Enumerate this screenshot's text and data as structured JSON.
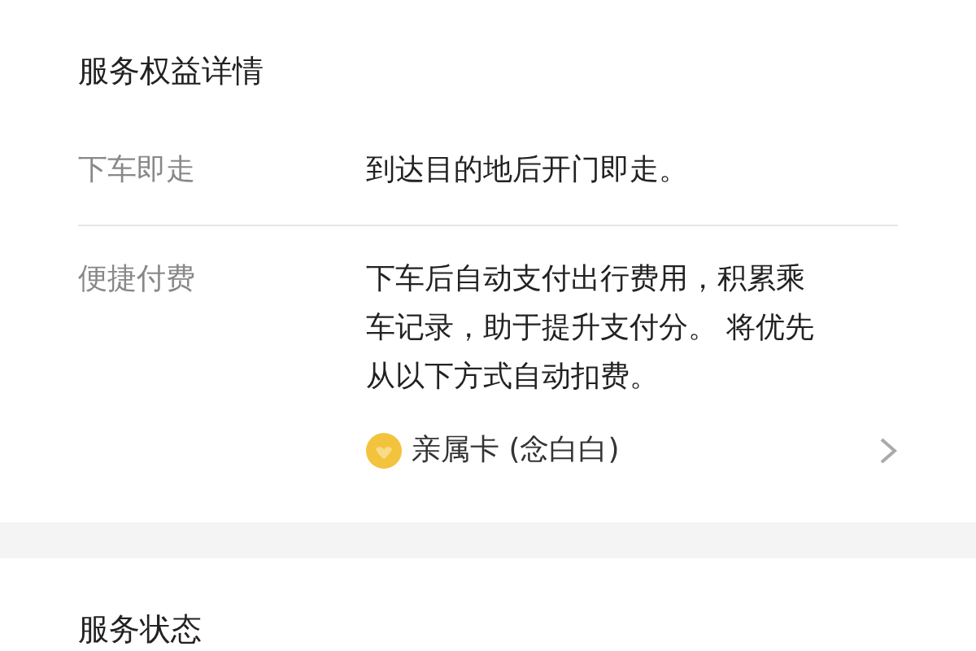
{
  "sections": [
    {
      "title": "服务权益详情",
      "rows": [
        {
          "label": "下车即走",
          "text": "到达目的地后开门即走。"
        },
        {
          "label": "便捷付费",
          "text": "下车后自动支付出行费用，积累乘车记录，助于提升支付分。 将优先从以下方式自动扣费。",
          "method": "亲属卡 (念白白)"
        }
      ]
    },
    {
      "title": "服务状态"
    }
  ]
}
